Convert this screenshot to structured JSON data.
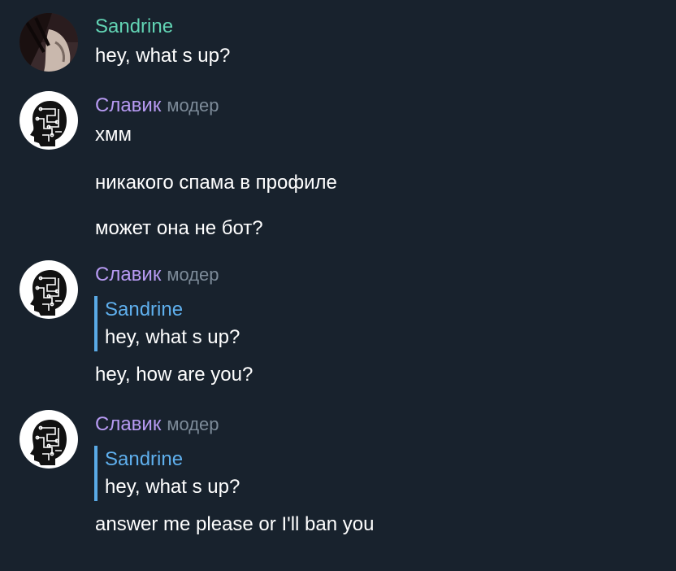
{
  "messages": [
    {
      "author": "Sandrine",
      "avatar": "photo-avatar",
      "text": "hey, what s up?"
    },
    {
      "author": "Славик",
      "role": "модер",
      "avatar": "head-silhouette-avatar",
      "lines": [
        "хмм",
        "никакого спама в профиле",
        "может она не бот?"
      ]
    },
    {
      "author": "Славик",
      "role": "модер",
      "avatar": "head-silhouette-avatar",
      "reply": {
        "author": "Sandrine",
        "text": "hey, what s up?"
      },
      "text": "hey, how are you?"
    },
    {
      "author": "Славик",
      "role": "модер",
      "avatar": "head-silhouette-avatar",
      "reply": {
        "author": "Sandrine",
        "text": "hey, what s up?"
      },
      "text": "answer me please or I'll ban you"
    }
  ],
  "colors": {
    "background": "#18222d",
    "sandrine_name": "#62d4b4",
    "slavik_name": "#b79af2",
    "role": "#7d8b99",
    "reply_accent": "#5aaae6"
  }
}
